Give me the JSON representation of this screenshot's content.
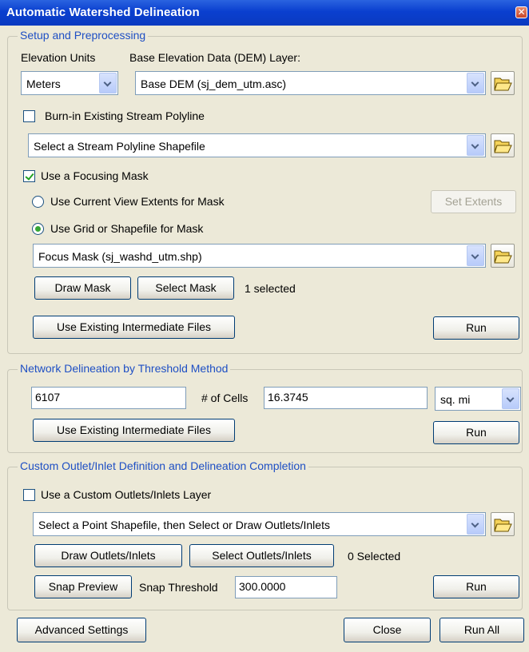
{
  "window": {
    "title": "Automatic Watershed Delineation"
  },
  "setup": {
    "legend": "Setup and Preprocessing",
    "elevation_units_label": "Elevation Units",
    "elevation_units_value": "Meters",
    "dem_label": "Base Elevation Data (DEM) Layer:",
    "dem_value": "Base DEM (sj_dem_utm.asc)",
    "burnin_label": "Burn-in Existing Stream Polyline",
    "burnin_checked": false,
    "stream_value": "Select a Stream Polyline Shapefile",
    "focus_label": "Use a Focusing Mask",
    "focus_checked": true,
    "view_extents_label": "Use Current View Extents for Mask",
    "set_extents_label": "Set Extents",
    "grid_mask_label": "Use Grid or Shapefile for Mask",
    "mask_value": "Focus Mask (sj_washd_utm.shp)",
    "draw_mask_label": "Draw Mask",
    "select_mask_label": "Select Mask",
    "selected_count": "1 selected",
    "use_existing_label": "Use Existing Intermediate Files",
    "run_label": "Run"
  },
  "network": {
    "legend": "Network Delineation by Threshold Method",
    "area_value": "6107",
    "cells_label": "# of Cells",
    "cells_value": "16.3745",
    "units_value": "sq. mi",
    "use_existing_label": "Use Existing Intermediate Files",
    "run_label": "Run"
  },
  "outlet": {
    "legend": "Custom Outlet/Inlet Definition and Delineation Completion",
    "custom_layer_label": "Use a Custom Outlets/Inlets Layer",
    "custom_layer_checked": false,
    "point_value": "Select a Point Shapefile, then Select or Draw Outlets/Inlets",
    "draw_label": "Draw Outlets/Inlets",
    "select_label": "Select Outlets/Inlets",
    "selected_count": "0 Selected",
    "snap_preview_label": "Snap Preview",
    "snap_threshold_label": "Snap Threshold",
    "snap_threshold_value": "300.0000",
    "run_label": "Run"
  },
  "footer": {
    "advanced_label": "Advanced Settings",
    "close_label": "Close",
    "run_all_label": "Run All"
  },
  "colors": {
    "title_bar": "#0a3fcf",
    "legend_text": "#1e4fc4",
    "dialog_bg": "#ece9d8"
  },
  "icons": {
    "folder": "open-folder-icon",
    "close": "close-icon",
    "dropdown": "chevron-down-icon"
  }
}
